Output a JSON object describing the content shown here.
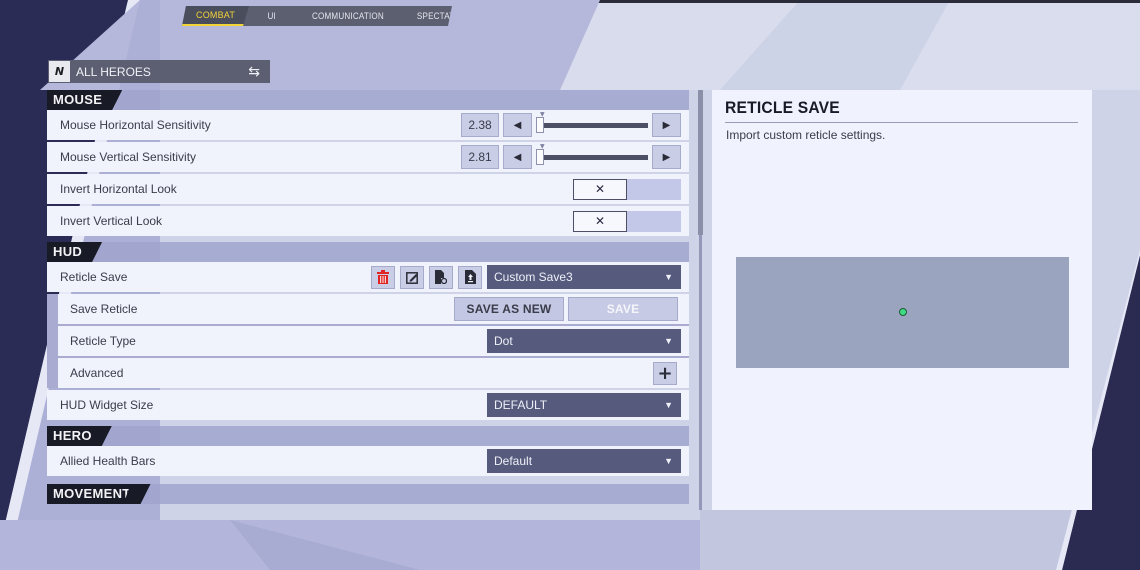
{
  "colors": {
    "accent": "#f2d338",
    "panel_dark": "#181a26",
    "dropdown_bg": "#565a7c",
    "delete_red": "#e02424",
    "reticle_color": "#3ddc84"
  },
  "tabs": [
    {
      "label": "COMBAT",
      "active": true
    },
    {
      "label": "UI",
      "active": false
    },
    {
      "label": "COMMUNICATION",
      "active": false
    },
    {
      "label": "SPECTATING",
      "active": false
    }
  ],
  "hero_select": {
    "label": "ALL HEROES",
    "logo_icon": "hero-logo-icon",
    "swap_icon": "swap-arrows-icon"
  },
  "sections": {
    "mouse": {
      "title": "MOUSE",
      "rows": {
        "horiz_sens": {
          "label": "Mouse Horizontal Sensitivity",
          "value": "2.38",
          "slider_fraction": 0.02
        },
        "vert_sens": {
          "label": "Mouse Vertical Sensitivity",
          "value": "2.81",
          "slider_fraction": 0.03
        },
        "invert_horiz": {
          "label": "Invert Horizontal Look",
          "state": "off",
          "symbol": "✕"
        },
        "invert_vert": {
          "label": "Invert Vertical Look",
          "state": "off",
          "symbol": "✕"
        }
      }
    },
    "hud": {
      "title": "HUD",
      "rows": {
        "reticle_save": {
          "label": "Reticle Save",
          "selected": "Custom Save3",
          "icons": [
            "trash-icon",
            "edit-icon",
            "save-file-icon",
            "import-file-icon"
          ]
        },
        "save_reticle": {
          "label": "Save Reticle",
          "save_as_new": "SAVE AS NEW",
          "save": "SAVE"
        },
        "reticle_type": {
          "label": "Reticle Type",
          "selected": "Dot"
        },
        "advanced": {
          "label": "Advanced",
          "expand_symbol": "+"
        },
        "hud_widget_size": {
          "label": "HUD Widget Size",
          "selected": "DEFAULT"
        }
      }
    },
    "hero": {
      "title": "HERO",
      "rows": {
        "allied_health_bars": {
          "label": "Allied Health Bars",
          "selected": "Default"
        }
      }
    },
    "movement": {
      "title": "MOVEMENT"
    }
  },
  "detail_panel": {
    "title": "RETICLE SAVE",
    "description": "Import custom reticle settings."
  },
  "glyphs": {
    "left_arrow": "◀",
    "right_arrow": "▶",
    "caret_down": "▼",
    "swap": "⇆",
    "logo": "N"
  }
}
